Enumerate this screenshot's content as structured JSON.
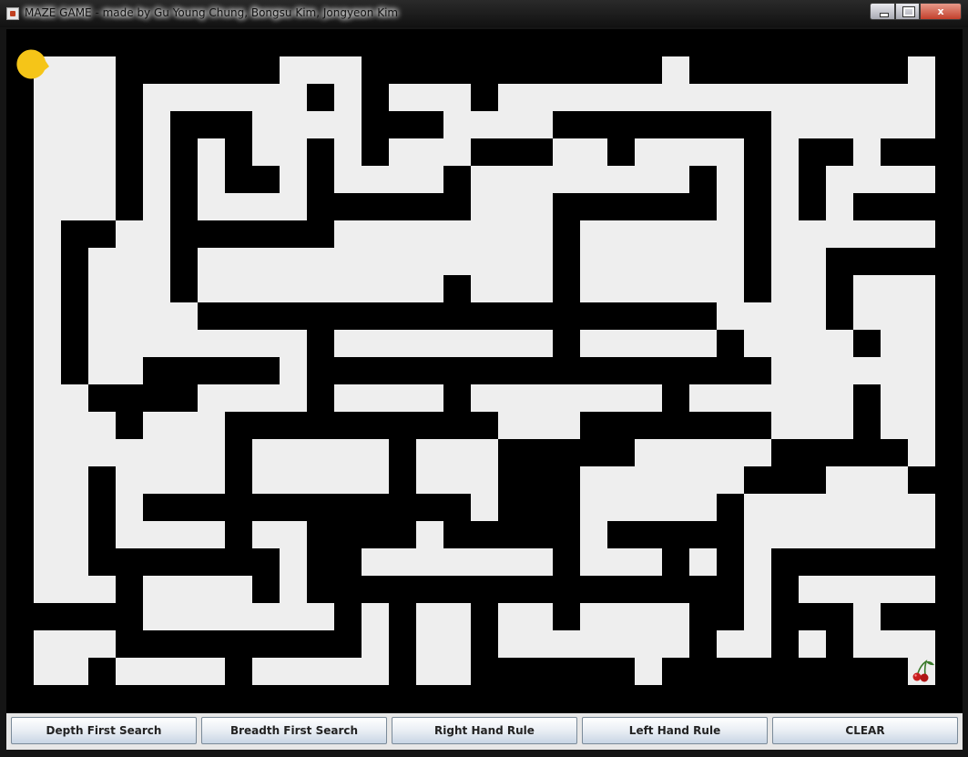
{
  "window": {
    "title": "MAZE GAME - made by Gu Young Chung,  Bongsu Kim,  Jongyeon Kim",
    "controls": {
      "minimize": "",
      "maximize": "",
      "close": "x"
    }
  },
  "maze": {
    "columns": 33,
    "rows": 23,
    "player": "pacman",
    "goal": "cherry",
    "colors": {
      "wall": "#000000",
      "path": "#eeeeee",
      "pacman": "#f5c518",
      "cherry": "#c81e1e",
      "stem": "#3a7a2a"
    }
  },
  "buttons": {
    "dfs": "Depth First Search",
    "bfs": "Breadth First Search",
    "right_hand": "Right Hand Rule",
    "left_hand": "Left Hand Rule",
    "clear": "CLEAR"
  }
}
